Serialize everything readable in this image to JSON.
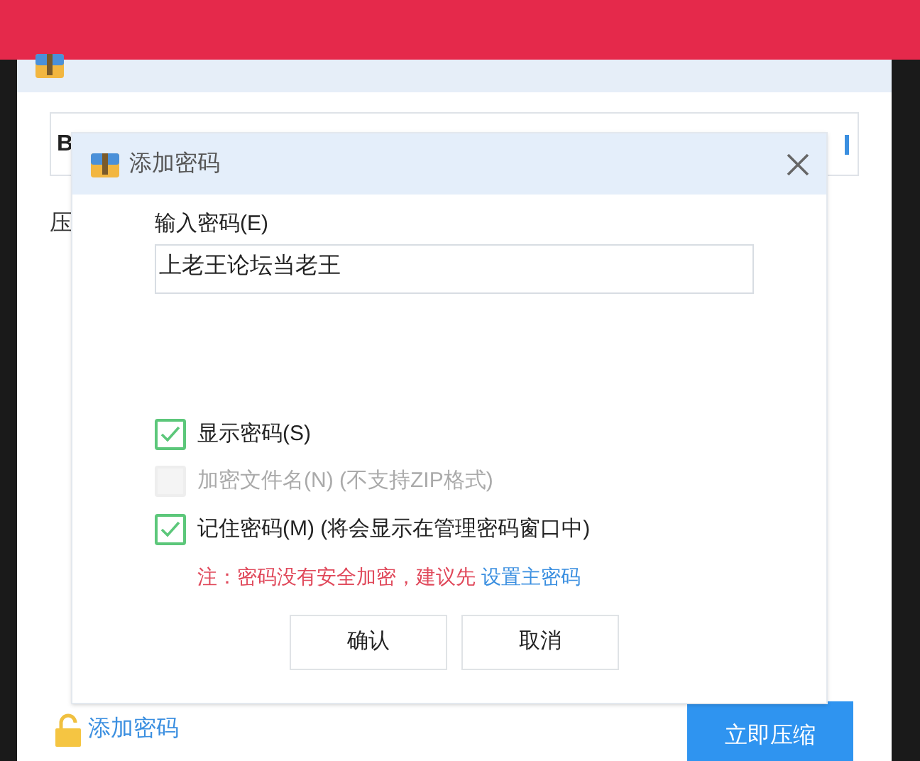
{
  "main_window": {
    "field_text": "B",
    "section_label": "压",
    "add_password_link": "添加密码",
    "compress_button": "立即压缩"
  },
  "dialog": {
    "title": "添加密码",
    "password_label": "输入密码(E)",
    "password_value": "上老王论坛当老王",
    "options": [
      {
        "label": "显示密码(S)",
        "checked": true,
        "disabled": false
      },
      {
        "label": "加密文件名(N) (不支持ZIP格式)",
        "checked": false,
        "disabled": true
      },
      {
        "label": "记住密码(M) (将会显示在管理密码窗口中)",
        "checked": true,
        "disabled": false
      }
    ],
    "note": "注：密码没有安全加密，建议先",
    "note_link": "设置主密码",
    "buttons": [
      "确认",
      "取消"
    ]
  }
}
